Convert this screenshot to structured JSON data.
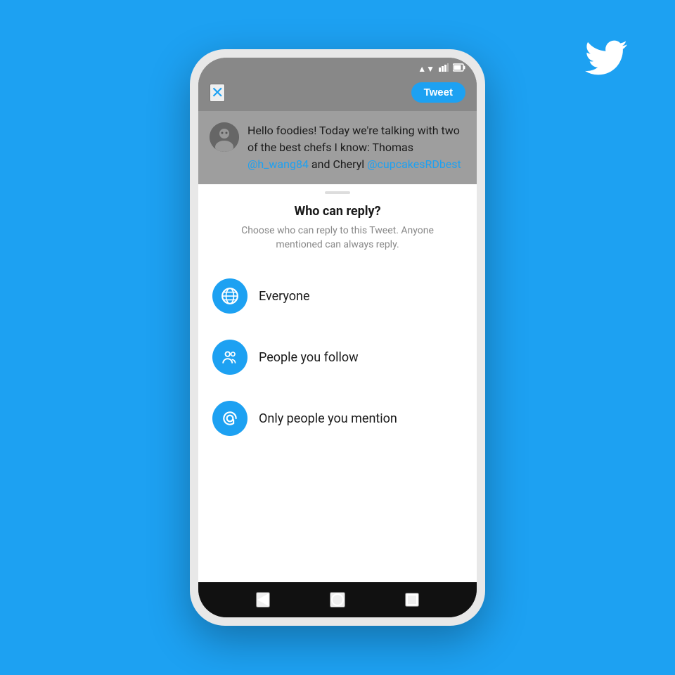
{
  "background_color": "#1DA1F2",
  "twitter_logo": {
    "aria_label": "Twitter bird logo"
  },
  "phone": {
    "status_bar": {
      "icons": [
        "wifi",
        "signal",
        "battery"
      ]
    },
    "top_bar": {
      "close_label": "✕",
      "tweet_button_label": "Tweet"
    },
    "tweet": {
      "text_before": "Hello foodies! Today we're talking with two of the best chefs I know: Thomas ",
      "mention1": "@h_wang84",
      "text_middle": " and Cheryl ",
      "mention2": "@cupcakesRDbest"
    },
    "bottom_sheet": {
      "handle_visible": true,
      "title": "Who can reply?",
      "subtitle": "Choose who can reply to this Tweet. Anyone mentioned can always reply.",
      "options": [
        {
          "id": "everyone",
          "icon": "globe",
          "label": "Everyone"
        },
        {
          "id": "people-you-follow",
          "icon": "group",
          "label": "People you follow"
        },
        {
          "id": "only-mention",
          "icon": "at",
          "label": "Only people you mention"
        }
      ]
    },
    "nav_bar": {
      "back_aria": "back",
      "home_aria": "home",
      "recent_aria": "recent apps"
    }
  }
}
